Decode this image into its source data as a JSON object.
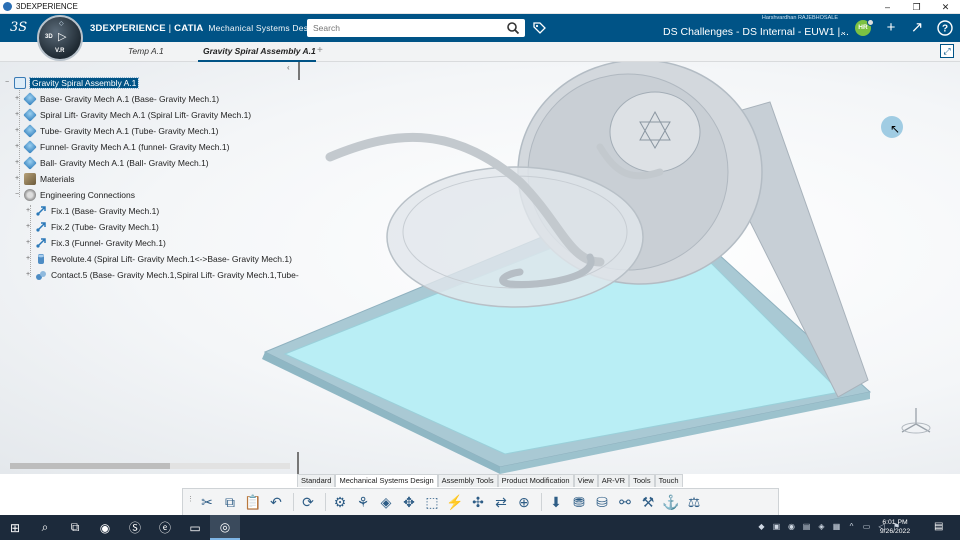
{
  "window": {
    "title": "3DEXPERIENCE",
    "controls": [
      "–",
      "❐",
      "✕"
    ]
  },
  "header": {
    "brand_bold": "3DEXPERIENCE",
    "brand_sep": " | ",
    "brand_app_bold": "CATIA",
    "brand_app": "Mechanical Systems Design",
    "search_placeholder": "Search",
    "user_name": "Harshvardhan RAJEBHOSALE",
    "collab_space": "DS Challenges - DS Internal - EUW1 |...",
    "avatar_initials": "HR",
    "colors": {
      "bar": "#005386",
      "avatar": "#7cc142"
    }
  },
  "compass": {
    "label_3d": "3D",
    "version": "V.R"
  },
  "tabs": [
    {
      "label": "Temp A.1",
      "active": false
    },
    {
      "label": "Gravity Spiral Assembly A.1",
      "active": true
    }
  ],
  "tree": {
    "root": "Gravity Spiral Assembly A.1",
    "items": [
      {
        "label": "Base- Gravity Mech A.1 (Base- Gravity Mech.1)",
        "icon": "part-icon"
      },
      {
        "label": "Spiral Lift- Gravity Mech A.1 (Spiral Lift- Gravity Mech.1)",
        "icon": "part-icon"
      },
      {
        "label": "Tube- Gravity Mech A.1 (Tube- Gravity Mech.1)",
        "icon": "part-icon"
      },
      {
        "label": "Funnel- Gravity Mech A.1 (funnel- Gravity Mech.1)",
        "icon": "part-icon"
      },
      {
        "label": "Ball- Gravity Mech A.1 (Ball- Gravity Mech.1)",
        "icon": "part-icon"
      },
      {
        "label": "Materials",
        "icon": "materials-icon"
      },
      {
        "label": "Engineering Connections",
        "icon": "engineering-connections-icon"
      }
    ],
    "connections": [
      {
        "label": "Fix.1 (Base- Gravity Mech.1)",
        "icon": "fix-icon"
      },
      {
        "label": "Fix.2 (Tube- Gravity Mech.1)",
        "icon": "fix-icon"
      },
      {
        "label": "Fix.3 (Funnel- Gravity Mech.1)",
        "icon": "fix-icon"
      },
      {
        "label": "Revolute.4 (Spiral Lift- Gravity Mech.1<->Base- Gravity Mech.1)",
        "icon": "revolute-icon"
      },
      {
        "label": "Contact.5 (Base- Gravity Mech.1,Spiral Lift- Gravity Mech.1,Tube-",
        "icon": "contact-icon"
      }
    ]
  },
  "action_tabs": [
    {
      "label": "Standard",
      "active": false
    },
    {
      "label": "Mechanical Systems Design",
      "active": true
    },
    {
      "label": "Assembly Tools",
      "active": false
    },
    {
      "label": "Product Modification",
      "active": false
    },
    {
      "label": "View",
      "active": false
    },
    {
      "label": "AR-VR",
      "active": false
    },
    {
      "label": "Tools",
      "active": false
    },
    {
      "label": "Touch",
      "active": false
    }
  ],
  "toolbar_icons": [
    "cut-icon",
    "copy-icon",
    "paste-icon",
    "undo-icon",
    "update-icon",
    "settings-icon",
    "insert-product-icon",
    "insert-part-icon",
    "explode-icon",
    "section-icon",
    "engineering-connection-icon",
    "constraint-icon",
    "pattern-icon",
    "replace-icon",
    "move-icon",
    "snap-icon",
    "clash-icon",
    "measure-icon",
    "distance-icon",
    "compass-icon",
    "balance-icon"
  ],
  "taskbar": {
    "time": "6:01 PM",
    "date": "9/26/2022"
  }
}
